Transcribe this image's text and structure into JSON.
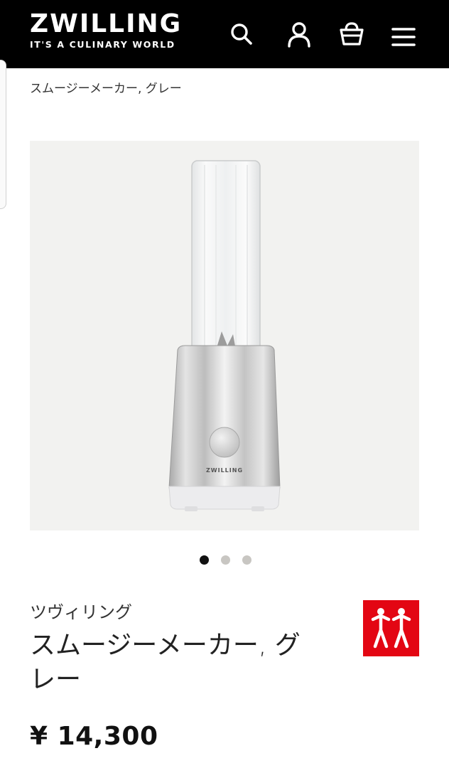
{
  "header": {
    "logo_main": "ZWILLING",
    "logo_sub": "IT'S A CULINARY WORLD",
    "icons": [
      "search-icon",
      "account-icon",
      "cart-icon",
      "menu-icon"
    ]
  },
  "breadcrumb": "スムージーメーカー, グレー",
  "gallery": {
    "slides": 3,
    "active_slide": 1,
    "image_branding": "ZWILLING"
  },
  "product": {
    "brand": "ツヴィリング",
    "title": "スムージーメーカー, グレー",
    "price": "¥ 14,300"
  },
  "colors": {
    "header_bg": "#000000",
    "badge_red": "#e30613",
    "dot_active": "#111111",
    "dot_inactive": "#c8c6c2"
  }
}
